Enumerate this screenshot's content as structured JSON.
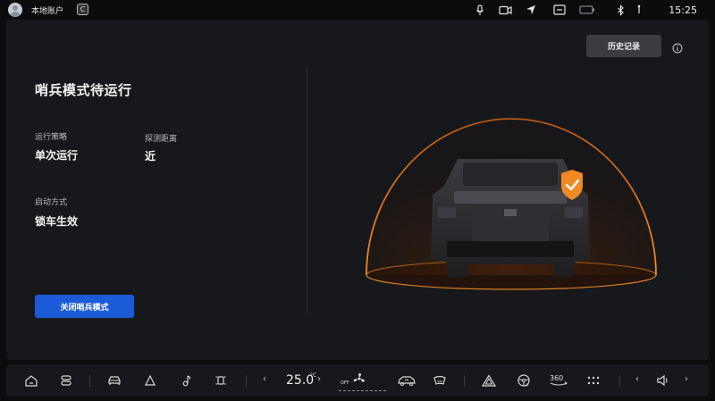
{
  "status_bar": {
    "account_name": "本地账户",
    "app_badge": "C",
    "time": "15:25",
    "icons": [
      "avatar-icon",
      "app-icon",
      "microphone-icon",
      "camera-icon",
      "location-arrow-icon",
      "screen-icon",
      "battery-icon",
      "bluetooth-icon",
      "signal-icon"
    ]
  },
  "main": {
    "title": "哨兵模式待运行",
    "strategy_label": "运行策略",
    "strategy_value": "单次运行",
    "distance_label": "探测距离",
    "distance_value": "近",
    "start_label": "启动方式",
    "start_value": "锁车生效",
    "close_button": "关闭哨兵模式",
    "history_button": "历史记录",
    "accent_color": "#1c5bd8",
    "shield_color": "#f08a24"
  },
  "dock": {
    "temperature": "25.0",
    "temperature_unit": "°C",
    "fan_state": "OFF",
    "left_arrow": "‹",
    "right_arrow": "›",
    "icons": [
      "home-icon",
      "switch-icon",
      "car-icon",
      "navigation-icon",
      "music-icon",
      "vehicle-settings-icon",
      "fan-icon",
      "car-air-icon",
      "defrost-icon",
      "warning-icon",
      "steering-wheel-icon",
      "camera-360-icon",
      "apps-grid-icon",
      "volume-icon"
    ],
    "camera_360_label": "360"
  }
}
